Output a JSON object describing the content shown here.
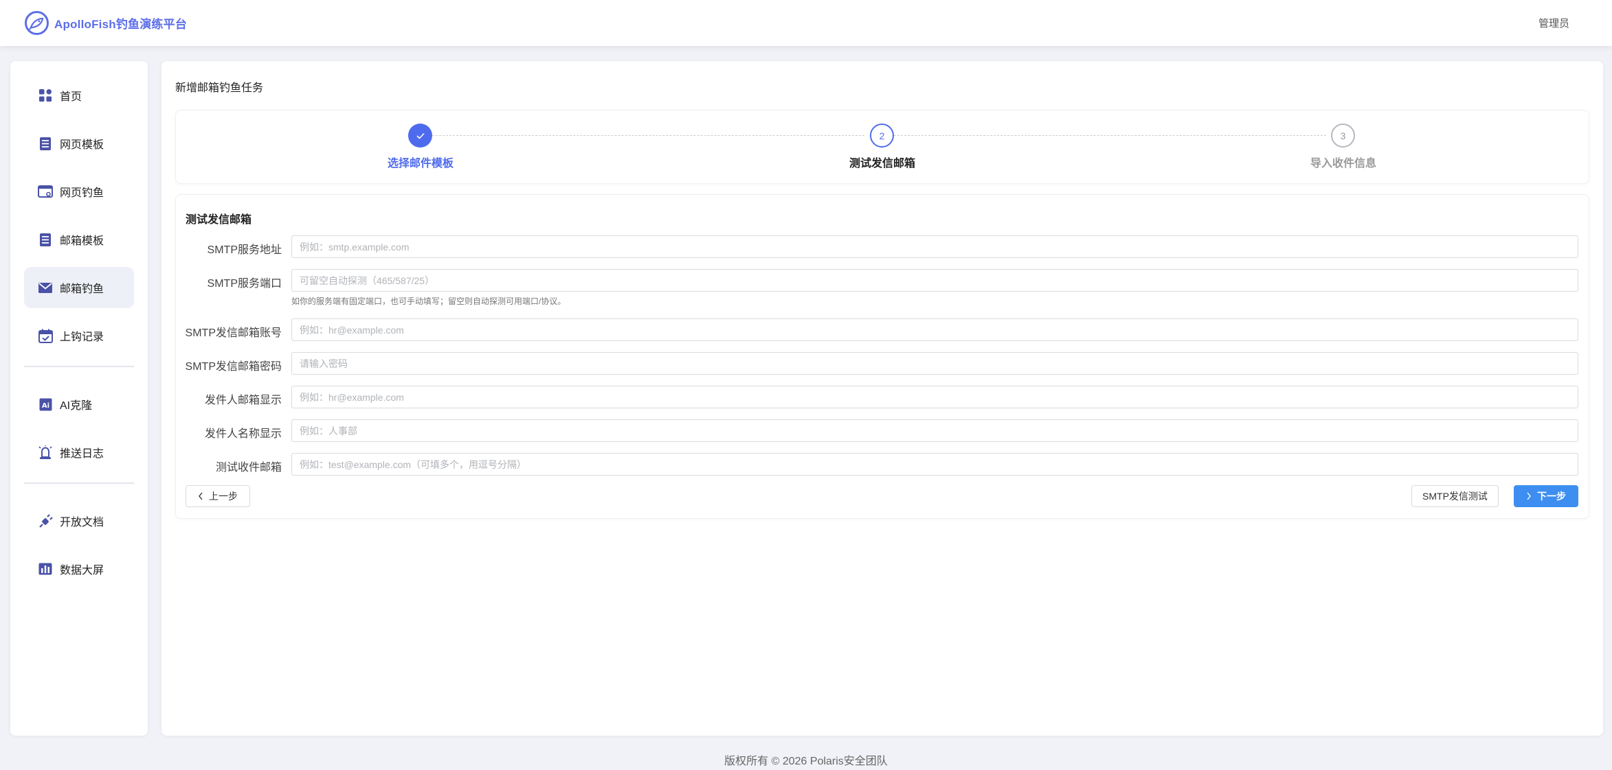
{
  "header": {
    "brand_title": "ApolloFish钓鱼演练平台",
    "user_name": "管理员"
  },
  "sidebar": {
    "items": [
      {
        "label": "首页",
        "icon": "dashboard-icon"
      },
      {
        "label": "网页模板",
        "icon": "document-icon"
      },
      {
        "label": "网页钓鱼",
        "icon": "browser-icon"
      },
      {
        "label": "邮箱模板",
        "icon": "document-icon"
      },
      {
        "label": "邮箱钓鱼",
        "icon": "mail-icon",
        "active": true
      },
      {
        "label": "上钩记录",
        "icon": "calendar-icon"
      }
    ],
    "items2": [
      {
        "label": "AI克隆",
        "icon": "ai-icon"
      },
      {
        "label": "推送日志",
        "icon": "bell-icon"
      }
    ],
    "items3": [
      {
        "label": "开放文档",
        "icon": "plug-icon"
      },
      {
        "label": "数据大屏",
        "icon": "chart-icon"
      }
    ]
  },
  "main": {
    "page_title": "新增邮箱钓鱼任务",
    "steps": [
      {
        "number": "1",
        "label": "选择邮件模板",
        "status": "done"
      },
      {
        "number": "2",
        "label": "测试发信邮箱",
        "status": "current"
      },
      {
        "number": "3",
        "label": "导入收件信息",
        "status": "pending"
      }
    ],
    "form": {
      "title": "测试发信邮箱",
      "fields": [
        {
          "label": "SMTP服务地址",
          "placeholder": "例如：smtp.example.com",
          "value": ""
        },
        {
          "label": "SMTP服务端口",
          "placeholder": "可留空自动探测（465/587/25）",
          "value": ""
        },
        {
          "label": "SMTP发信邮箱账号",
          "placeholder": "例如：hr@example.com",
          "value": ""
        },
        {
          "label": "SMTP发信邮箱密码",
          "placeholder": "请输入密码",
          "value": ""
        },
        {
          "label": "发件人邮箱显示",
          "placeholder": "例如：hr@example.com",
          "value": ""
        },
        {
          "label": "发件人名称显示",
          "placeholder": "例如：人事部",
          "value": ""
        },
        {
          "label": "测试收件邮箱",
          "placeholder": "例如：test@example.com（可填多个，用逗号分隔）",
          "value": ""
        }
      ],
      "port_hint": "如你的服务端有固定端口，也可手动填写；留空则自动探测可用端口/协议。",
      "prev_label": "上一步",
      "test_label": "SMTP发信测试",
      "next_label": "下一步"
    }
  },
  "footer": {
    "copyright": "版权所有 © 2026 Polaris安全团队"
  },
  "colors": {
    "brand": "#5b6ee8",
    "step_active": "#4f6bed",
    "primary_button": "#3d8ef0",
    "sidebar_icon": "#4a52a8"
  }
}
